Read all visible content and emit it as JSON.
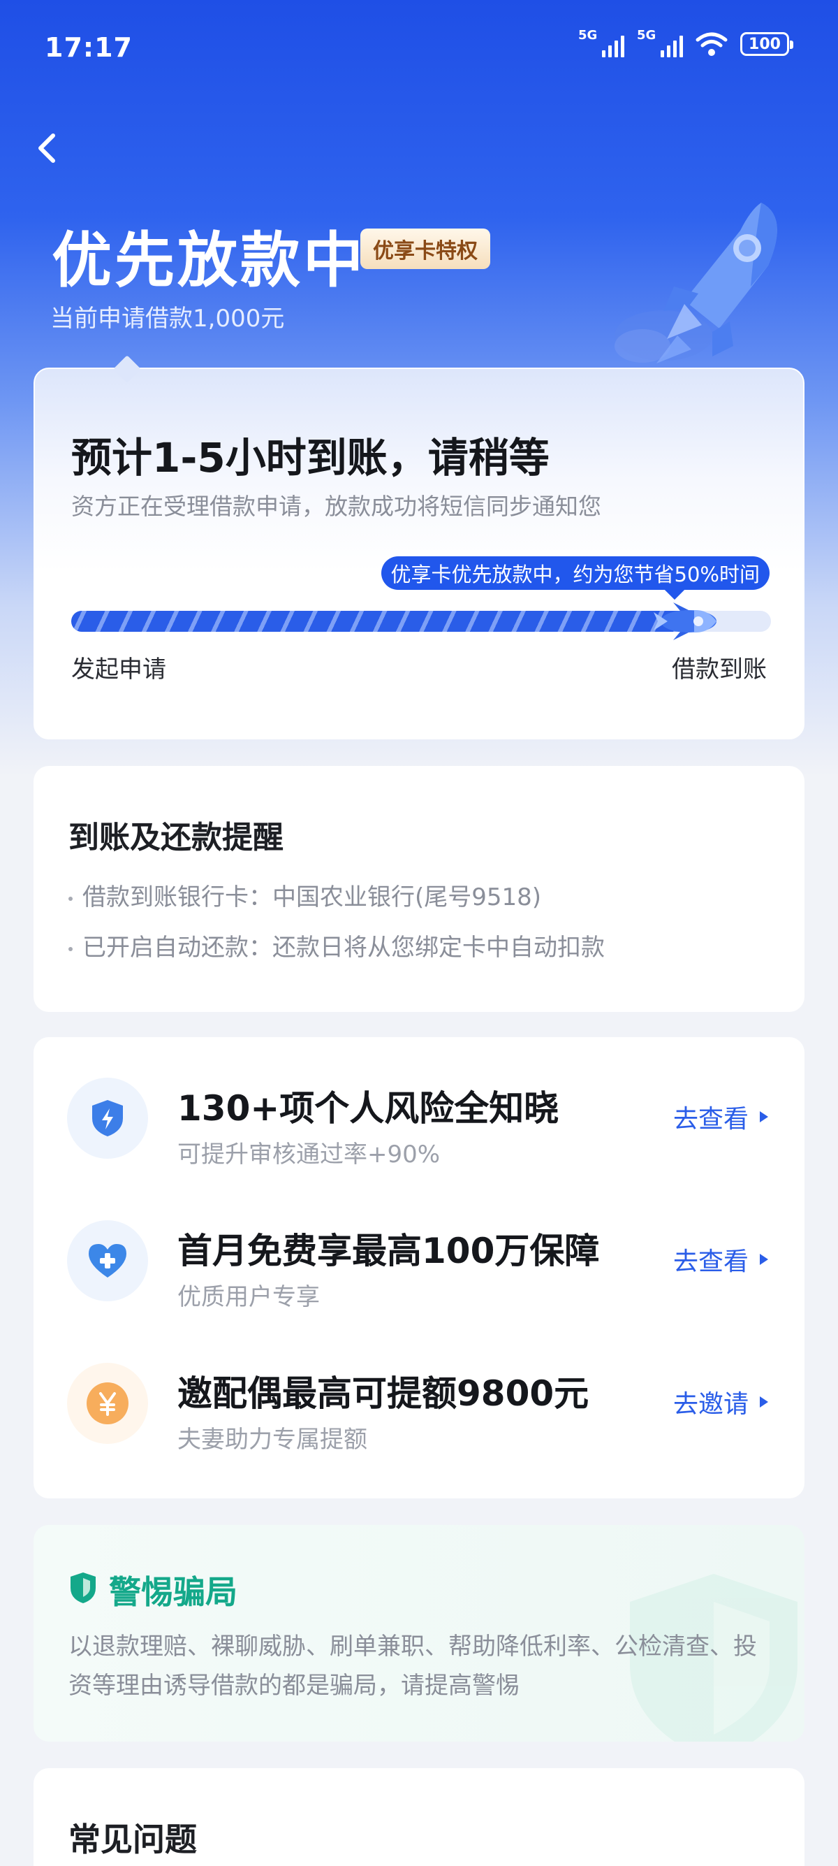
{
  "status_bar": {
    "time": "17:17",
    "network_1": "5G",
    "network_2": "5G",
    "battery": "100"
  },
  "header": {
    "title": "优先放款中",
    "badge": "优享卡特权",
    "subtitle": "当前申请借款1,000元"
  },
  "progress": {
    "title": "预计1-5小时到账，请稍等",
    "subtitle": "资方正在受理借款申请，放款成功将短信同步通知您",
    "tip": "优享卡优先放款中，约为您节省50%时间",
    "level": 0.9,
    "start_label": "发起申请",
    "end_label": "借款到账"
  },
  "reminder": {
    "title": "到账及还款提醒",
    "lines": [
      "借款到账银行卡：中国农业银行(尾号9518)",
      "已开启自动还款：还款日将从您绑定卡中自动扣款"
    ]
  },
  "services": [
    {
      "title": "130+项个人风险全知晓",
      "subtitle": "可提升审核通过率+90%",
      "action": "去查看",
      "icon": "shield-bolt-icon",
      "icon_bg": "#eef4fd",
      "icon_color": "#3c7ee8"
    },
    {
      "title": "首月免费享最高100万保障",
      "subtitle": "优质用户专享",
      "action": "去查看",
      "icon": "heart-plus-icon",
      "icon_bg": "#eef4fd",
      "icon_color": "#3c87e8"
    },
    {
      "title": "邀配偶最高可提额9800元",
      "subtitle": "夫妻助力专属提额",
      "action": "去邀请",
      "icon": "yen-coin-icon",
      "icon_bg": "#fff6ec",
      "icon_color": "#f7ad5c"
    }
  ],
  "warning": {
    "title": "警惕骗局",
    "text": "以退款理赔、裸聊威胁、刷单兼职、帮助降低利率、公检清查、投资等理由诱导借款的都是骗局，请提高警惕",
    "color": "#14a88a"
  },
  "faq": {
    "title": "常见问题"
  },
  "colors": {
    "primary": "#2a5de8",
    "hero_top": "#1f4fe6"
  }
}
